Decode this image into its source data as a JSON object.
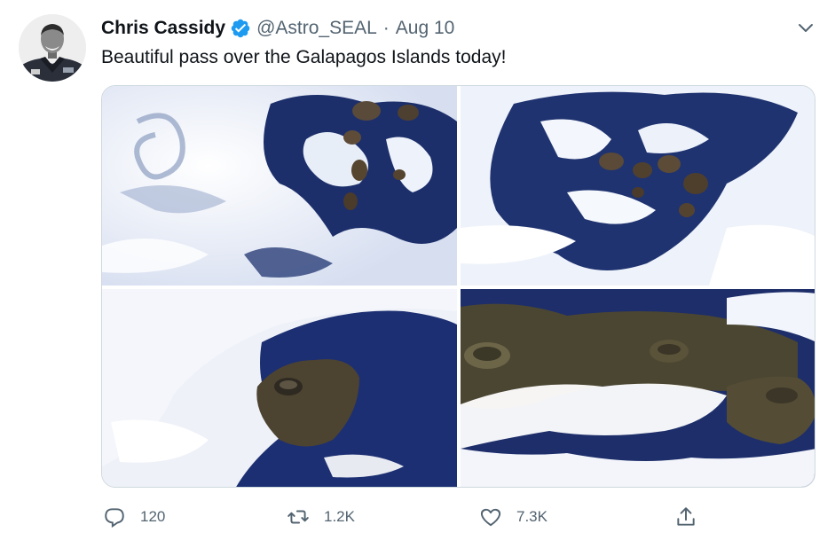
{
  "tweet": {
    "display_name": "Chris Cassidy",
    "handle": "@Astro_SEAL",
    "separator": "·",
    "date": "Aug 10",
    "verified": true,
    "text": "Beautiful pass over the Galapagos Islands today!",
    "menu_icon": "chevron-down-icon"
  },
  "media": {
    "count": 4
  },
  "actions": {
    "reply": {
      "icon": "reply-icon",
      "count": "120"
    },
    "retweet": {
      "icon": "retweet-icon",
      "count": "1.2K"
    },
    "like": {
      "icon": "heart-icon",
      "count": "7.3K"
    },
    "share": {
      "icon": "share-icon"
    }
  },
  "colors": {
    "text_primary": "#0f1419",
    "text_secondary": "#536471",
    "verified_blue": "#1d9bf0",
    "border": "#cfd9de"
  }
}
